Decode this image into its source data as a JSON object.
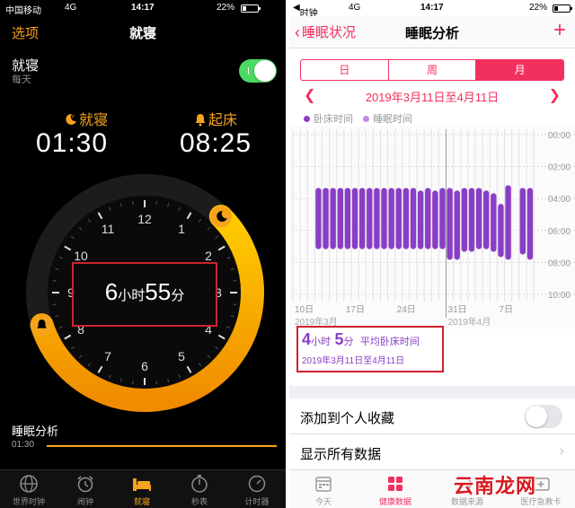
{
  "left": {
    "status": {
      "carrier": "中国移动",
      "network": "4G",
      "time": "14:17",
      "battery": "22%",
      "battery_level": 0.22
    },
    "nav": {
      "options": "选项",
      "title": "就寝"
    },
    "bedtime_row": {
      "label": "就寝",
      "sub": "每天",
      "enabled": true
    },
    "bedtime": {
      "label": "就寝",
      "time": "01:30"
    },
    "wake": {
      "label": "起床",
      "time": "08:25"
    },
    "dial": {
      "hours": [
        "12",
        "1",
        "2",
        "3",
        "4",
        "5",
        "6",
        "7",
        "8",
        "9",
        "10",
        "11"
      ],
      "duration": {
        "hours": "6",
        "hours_unit": "小时",
        "minutes": "55",
        "minutes_unit": "分"
      }
    },
    "analysis": {
      "title": "睡眠分析",
      "time": "01:30"
    },
    "tabs": [
      {
        "label": "世界时钟",
        "icon": "globe-icon"
      },
      {
        "label": "闹钟",
        "icon": "alarm-clock-icon"
      },
      {
        "label": "就寝",
        "icon": "bed-icon",
        "active": true
      },
      {
        "label": "秒表",
        "icon": "stopwatch-icon"
      },
      {
        "label": "计时器",
        "icon": "timer-icon"
      }
    ],
    "colors": {
      "accent": "#f7a31c",
      "toggle_on": "#4cd964"
    }
  },
  "right": {
    "status": {
      "back_app": "时钟",
      "network": "4G",
      "time": "14:17",
      "battery": "22%",
      "battery_level": 0.22
    },
    "nav": {
      "back": "睡眠状况",
      "title": "睡眠分析",
      "add": "+"
    },
    "segments": [
      {
        "label": "日",
        "selected": false
      },
      {
        "label": "周",
        "selected": false
      },
      {
        "label": "月",
        "selected": true
      }
    ],
    "range": "2019年3月11日至4月11日",
    "legend": [
      {
        "label": "卧床时间",
        "color": "#8a3ec6"
      },
      {
        "label": "睡眠时间",
        "color": "#c78ae6"
      }
    ],
    "summary": {
      "hours": "4",
      "hours_unit": "小时",
      "minutes": "5",
      "minutes_unit": "分",
      "label": "平均卧床时间",
      "range": "2019年3月11日至4月11日"
    },
    "rows": {
      "favorite": "添加到个人收藏",
      "show_all": "显示所有数据"
    },
    "tabs": [
      {
        "label": "今天",
        "icon": "calendar-icon"
      },
      {
        "label": "健康数据",
        "icon": "grid-icon",
        "active": true
      },
      {
        "label": "数据来源",
        "icon": "sources-icon"
      },
      {
        "label": "医疗急救卡",
        "icon": "medical-id-icon"
      }
    ],
    "colors": {
      "accent": "#f2305e",
      "bar": "#8a3ec6"
    }
  },
  "watermark": "云南龙网",
  "chart_data": {
    "type": "bar",
    "subtype": "floating-range",
    "title": "",
    "xlabel": "",
    "ylabel": "",
    "y_ticks": [
      "00:00",
      "02:00",
      "04:00",
      "06:00",
      "08:00",
      "10:00"
    ],
    "ylim": [
      "00:00",
      "10:00"
    ],
    "y_inverted": true,
    "x_ticks": [
      "10日",
      "17日",
      "24日",
      "31日",
      "7日"
    ],
    "x_month_labels": [
      "2019年3月",
      "2019年4月"
    ],
    "x_range": [
      "2019-03-10",
      "2019-04-11"
    ],
    "grid": true,
    "legend_position": "top-left",
    "series": [
      {
        "name": "卧床时间",
        "color": "#8a3ec6",
        "x": [
          "2019-03-13",
          "2019-03-14",
          "2019-03-15",
          "2019-03-16",
          "2019-03-17",
          "2019-03-18",
          "2019-03-19",
          "2019-03-20",
          "2019-03-21",
          "2019-03-22",
          "2019-03-23",
          "2019-03-24",
          "2019-03-25",
          "2019-03-26",
          "2019-03-27",
          "2019-03-28",
          "2019-03-29",
          "2019-03-30",
          "2019-03-31",
          "2019-04-01",
          "2019-04-02",
          "2019-04-03",
          "2019-04-04",
          "2019-04-05",
          "2019-04-06",
          "2019-04-07",
          "2019-04-08",
          "2019-04-10",
          "2019-04-11"
        ],
        "start": [
          "03:20",
          "03:20",
          "03:20",
          "03:20",
          "03:20",
          "03:20",
          "03:20",
          "03:20",
          "03:20",
          "03:20",
          "03:20",
          "03:20",
          "03:20",
          "03:20",
          "03:30",
          "03:20",
          "03:30",
          "03:20",
          "03:20",
          "03:30",
          "03:20",
          "03:20",
          "03:20",
          "03:30",
          "03:40",
          "04:20",
          "03:10",
          "03:20",
          "03:20"
        ],
        "end": [
          "07:10",
          "07:10",
          "07:10",
          "07:10",
          "07:10",
          "07:10",
          "07:10",
          "07:10",
          "07:10",
          "07:10",
          "07:10",
          "07:10",
          "07:10",
          "07:10",
          "07:10",
          "07:10",
          "07:10",
          "07:10",
          "07:50",
          "07:50",
          "07:20",
          "07:20",
          "07:10",
          "07:10",
          "07:20",
          "07:40",
          "07:50",
          "07:30",
          "07:50"
        ]
      }
    ]
  }
}
